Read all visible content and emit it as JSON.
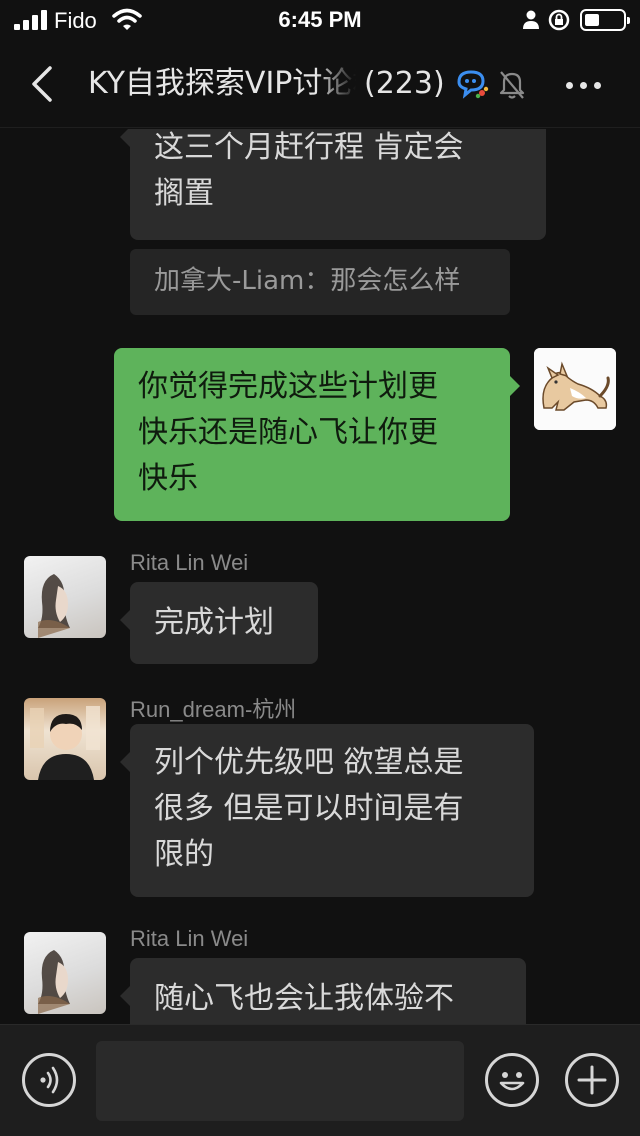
{
  "status_bar": {
    "carrier": "Fido",
    "time": "6:45 PM",
    "icons": [
      "signal-icon",
      "wifi-icon",
      "person-icon",
      "orientation-lock-icon",
      "battery-icon"
    ]
  },
  "nav": {
    "title": "KY自我探索VIP讨论群",
    "member_count": "(223)",
    "icons": [
      "back-arrow-icon",
      "chat-bubble-icon",
      "muted-bell-icon",
      "more-dots-icon"
    ]
  },
  "messages": [
    {
      "side": "left",
      "text_line1": "这三个月赶行程 肯定会",
      "text_line2": "搁置"
    },
    {
      "type": "quote",
      "text": "加拿大-Liam：那会怎么样"
    },
    {
      "side": "right",
      "line1": "你觉得完成这些计划更",
      "line2": "快乐还是随心飞让你更",
      "line3": "快乐"
    },
    {
      "side": "left",
      "sender": "Rita Lin Wei",
      "text": "完成计划"
    },
    {
      "side": "left",
      "sender": "Run_dream-杭州",
      "line1": "列个优先级吧 欲望总是",
      "line2": "很多 但是可以时间是有",
      "line3": "限的"
    },
    {
      "side": "left",
      "sender": "Rita Lin Wei",
      "text": "随心飞也会让我体验不"
    }
  ],
  "input_bar": {
    "placeholder": "",
    "icons": [
      "voice-icon",
      "emoji-icon",
      "plus-icon"
    ]
  },
  "colors": {
    "background": "#111111",
    "bubble_incoming": "#2c2c2c",
    "bubble_outgoing": "#5eb35b",
    "input_bar": "#1e1e1e"
  }
}
